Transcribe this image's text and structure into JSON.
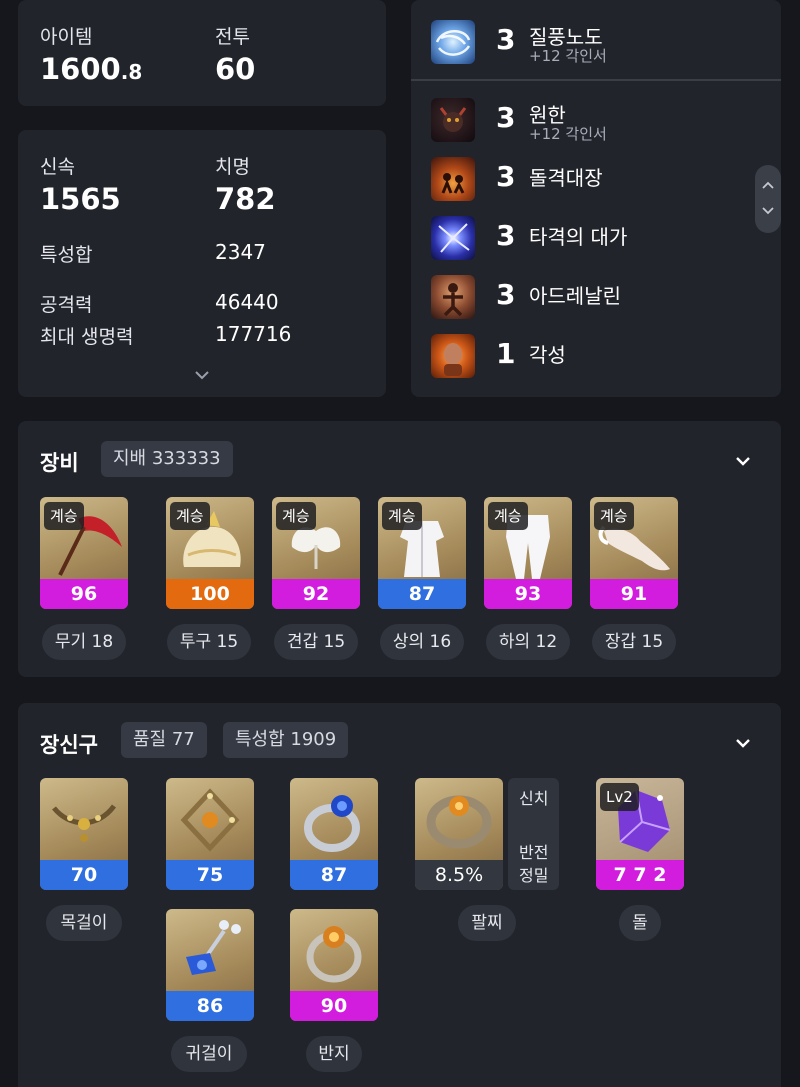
{
  "summary": {
    "item_level_label": "아이템",
    "item_level_int": "1600",
    "item_level_dec": ".8",
    "combat_label": "전투",
    "combat_value": "60"
  },
  "stats": {
    "swift_label": "신속",
    "swift_value": "1565",
    "crit_label": "치명",
    "crit_value": "782",
    "total_label": "특성합",
    "total_value": "2347",
    "atk_label": "공격력",
    "atk_value": "46440",
    "hp_label": "최대 생명력",
    "hp_value": "177716"
  },
  "engravings": [
    {
      "level": "3",
      "name": "질풍노도",
      "sub": "+12 각인서",
      "icon": "wind-swirl-icon",
      "color": "#4a7fc8"
    },
    {
      "level": "3",
      "name": "원한",
      "sub": "+12 각인서",
      "icon": "demon-icon",
      "color": "#7a2a20"
    },
    {
      "level": "3",
      "name": "돌격대장",
      "sub": "",
      "icon": "charge-icon",
      "color": "#9a3a18"
    },
    {
      "level": "3",
      "name": "타격의 대가",
      "sub": "",
      "icon": "strike-icon",
      "color": "#3848c8"
    },
    {
      "level": "3",
      "name": "아드레날린",
      "sub": "",
      "icon": "adrenaline-icon",
      "color": "#8a4a30"
    },
    {
      "level": "1",
      "name": "각성",
      "sub": "",
      "icon": "awaken-icon",
      "color": "#c45a1a"
    }
  ],
  "equipment": {
    "title": "장비",
    "badge": "지배 333333",
    "items": [
      {
        "tag": "계승",
        "quality": "96",
        "bar_color": "#d21ddf",
        "label": "무기 18",
        "icon": "weapon-icon"
      },
      {
        "tag": "계승",
        "quality": "100",
        "bar_color": "#e36a0f",
        "label": "투구 15",
        "icon": "helmet-icon"
      },
      {
        "tag": "계승",
        "quality": "92",
        "bar_color": "#d21ddf",
        "label": "견갑 15",
        "icon": "shoulder-icon"
      },
      {
        "tag": "계승",
        "quality": "87",
        "bar_color": "#2f6fe0",
        "label": "상의 16",
        "icon": "chest-icon"
      },
      {
        "tag": "계승",
        "quality": "93",
        "bar_color": "#d21ddf",
        "label": "하의 12",
        "icon": "pants-icon"
      },
      {
        "tag": "계승",
        "quality": "91",
        "bar_color": "#d21ddf",
        "label": "장갑 15",
        "icon": "gloves-icon"
      }
    ]
  },
  "accessories": {
    "title": "장신구",
    "badge_quality": "품질 77",
    "badge_total": "특성합 1909",
    "necklace": {
      "quality": "70",
      "bar_color": "#2f6fe0",
      "label": "목걸이"
    },
    "earring1": {
      "quality": "75",
      "bar_color": "#2f6fe0"
    },
    "ring1": {
      "quality": "87",
      "bar_color": "#2f6fe0"
    },
    "earring2": {
      "quality": "86",
      "bar_color": "#2f6fe0",
      "label": "귀걸이"
    },
    "ring2": {
      "quality": "90",
      "bar_color": "#d21ddf",
      "label": "반지"
    },
    "bracelet": {
      "value": "8.5%",
      "label": "팔찌",
      "effects": [
        "신치",
        "반전",
        "정밀"
      ]
    },
    "stone": {
      "tag": "Lv2",
      "value": "7 7 2",
      "bar_color": "#d21ddf",
      "label": "돌"
    }
  }
}
